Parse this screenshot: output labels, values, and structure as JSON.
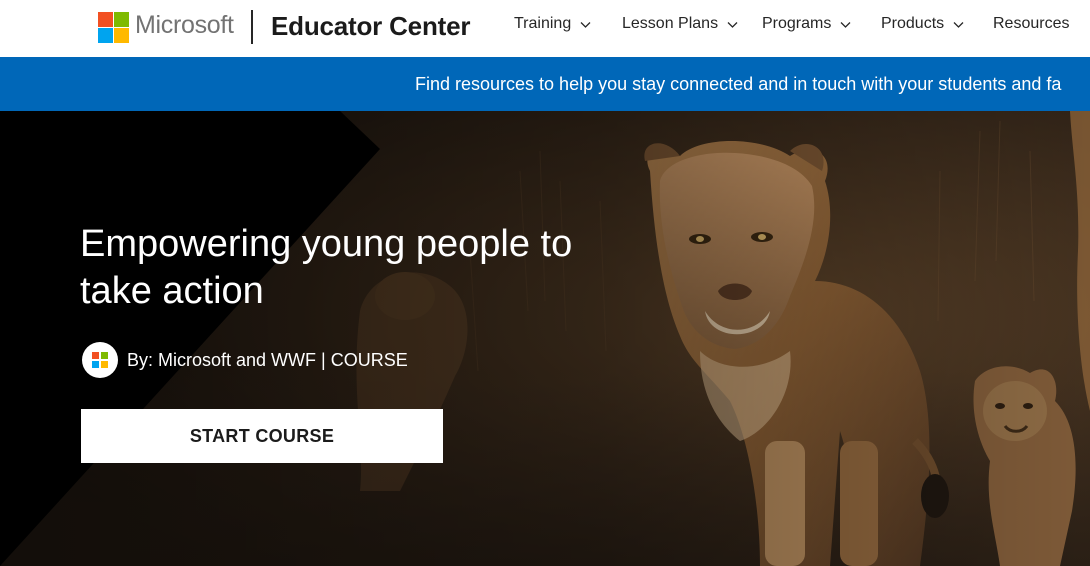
{
  "header": {
    "brand_name": "Microsoft",
    "site_title": "Educator Center",
    "logo_colors": [
      "#f25022",
      "#7fba00",
      "#00a4ef",
      "#ffb900"
    ],
    "nav": [
      {
        "label": "Training",
        "has_dropdown": true
      },
      {
        "label": "Lesson Plans",
        "has_dropdown": true
      },
      {
        "label": "Programs",
        "has_dropdown": true
      },
      {
        "label": "Products",
        "has_dropdown": true
      },
      {
        "label": "Resources",
        "has_dropdown": false
      }
    ]
  },
  "banner": {
    "text": "Find resources to help you stay connected and in touch with your students and fa",
    "background": "#0067b8"
  },
  "hero": {
    "title": "Empowering young people to take action",
    "byline": "By: Microsoft and WWF | COURSE",
    "cta_label": "START COURSE"
  },
  "colors": {
    "accent": "#0067b8",
    "text_dark": "#262626"
  }
}
